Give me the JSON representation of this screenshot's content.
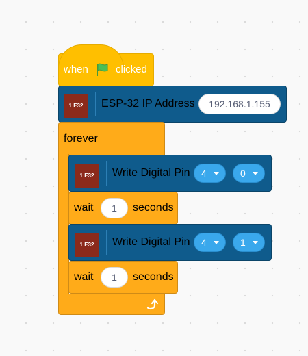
{
  "hat": {
    "when_label": "when",
    "icon": "green-flag-icon",
    "clicked_label": "clicked"
  },
  "ip_block": {
    "icon_label": "1 E32",
    "label": "ESP-32 IP Address",
    "value": "192.168.1.155"
  },
  "forever": {
    "label": "forever",
    "loop_icon": "loop-arrow-icon"
  },
  "write1": {
    "icon_label": "1 E32",
    "label": "Write Digital Pin",
    "pin": "4",
    "value": "0"
  },
  "wait1": {
    "label": "wait",
    "value": "1",
    "unit": "seconds"
  },
  "write2": {
    "icon_label": "1 E32",
    "label": "Write Digital Pin",
    "pin": "4",
    "value": "1"
  },
  "wait2": {
    "label": "wait",
    "value": "1",
    "unit": "seconds"
  },
  "colors": {
    "event": "#ffbf00",
    "control": "#ffab19",
    "extension": "#0f5b8c",
    "dropdown": "#3aa8ec",
    "extension_icon": "#8b2a1b"
  }
}
